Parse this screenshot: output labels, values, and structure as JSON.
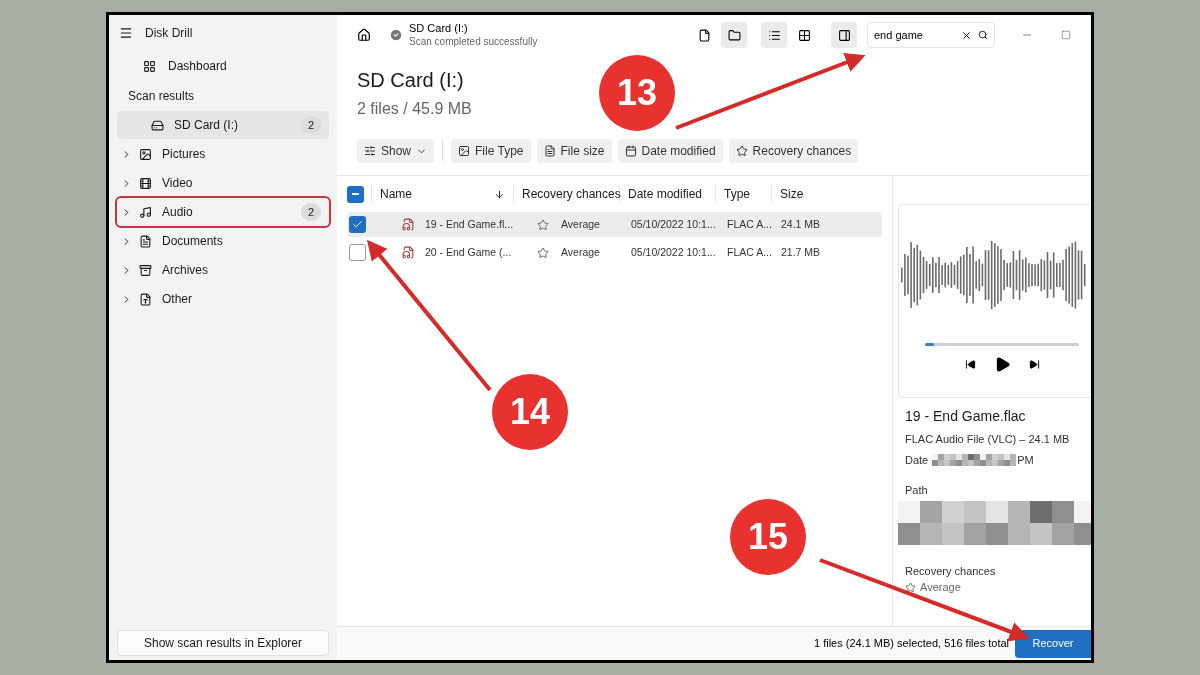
{
  "app": {
    "title": "Disk Drill"
  },
  "sidebar": {
    "dashboard": "Dashboard",
    "section": "Scan results",
    "items": [
      {
        "kind": "drive",
        "label": "SD Card (I:)",
        "count": "2",
        "selected": true,
        "expandable": false,
        "annotated": false
      },
      {
        "kind": "pictures",
        "label": "Pictures",
        "selected": false,
        "expandable": true,
        "annotated": false
      },
      {
        "kind": "video",
        "label": "Video",
        "selected": false,
        "expandable": true,
        "annotated": false
      },
      {
        "kind": "audio",
        "label": "Audio",
        "count": "2",
        "selected": false,
        "expandable": true,
        "annotated": true
      },
      {
        "kind": "documents",
        "label": "Documents",
        "selected": false,
        "expandable": true,
        "annotated": false
      },
      {
        "kind": "archives",
        "label": "Archives",
        "selected": false,
        "expandable": true,
        "annotated": false
      },
      {
        "kind": "other",
        "label": "Other",
        "selected": false,
        "expandable": true,
        "annotated": false
      }
    ],
    "footer_button": "Show scan results in Explorer"
  },
  "header": {
    "title": "SD Card (I:)",
    "status": "Scan completed successfully",
    "tools": [
      {
        "kind": "file",
        "selected": false
      },
      {
        "kind": "folder",
        "selected": true
      },
      {
        "kind": "list",
        "selected": true
      },
      {
        "kind": "grid",
        "selected": false
      },
      {
        "kind": "preview",
        "selected": true
      }
    ],
    "search": {
      "value": "end game"
    }
  },
  "heading": "SD Card (I:)",
  "summary": "2 files / 45.9 MB",
  "filters": [
    {
      "kind": "show",
      "label": "Show"
    },
    {
      "kind": "type",
      "label": "File Type"
    },
    {
      "kind": "size",
      "label": "File size"
    },
    {
      "kind": "date",
      "label": "Date modified"
    },
    {
      "kind": "recovery",
      "label": "Recovery chances"
    }
  ],
  "table": {
    "indeterminate": true,
    "columns": [
      "Name",
      "Recovery chances",
      "Date modified",
      "Type",
      "Size"
    ],
    "rows": [
      {
        "name": "19 - End Game.fl...",
        "recovery": "Average",
        "date": "05/10/2022 10:1...",
        "type": "FLAC A...",
        "size": "24.1 MB",
        "checked": true,
        "selected": true
      },
      {
        "name": "20 - End Game (...",
        "recovery": "Average",
        "date": "05/10/2022 10:1...",
        "type": "FLAC A...",
        "size": "21.7 MB",
        "checked": false,
        "selected": false
      }
    ]
  },
  "preview": {
    "player": {
      "level": 0.06
    },
    "file_name": "19 - End Game.flac",
    "details": "FLAC Audio File (VLC) – 24.1 MB",
    "date_label": "Date",
    "date_tail": "PM",
    "path_label": "Path",
    "recovery_label": "Recovery chances",
    "recovery_value": "Average"
  },
  "status_bar": {
    "text": "1 files (24.1 MB) selected, 516 files total",
    "button": "Recover"
  },
  "annotations": [
    {
      "label": "13"
    },
    {
      "label": "14"
    },
    {
      "label": "15"
    }
  ]
}
